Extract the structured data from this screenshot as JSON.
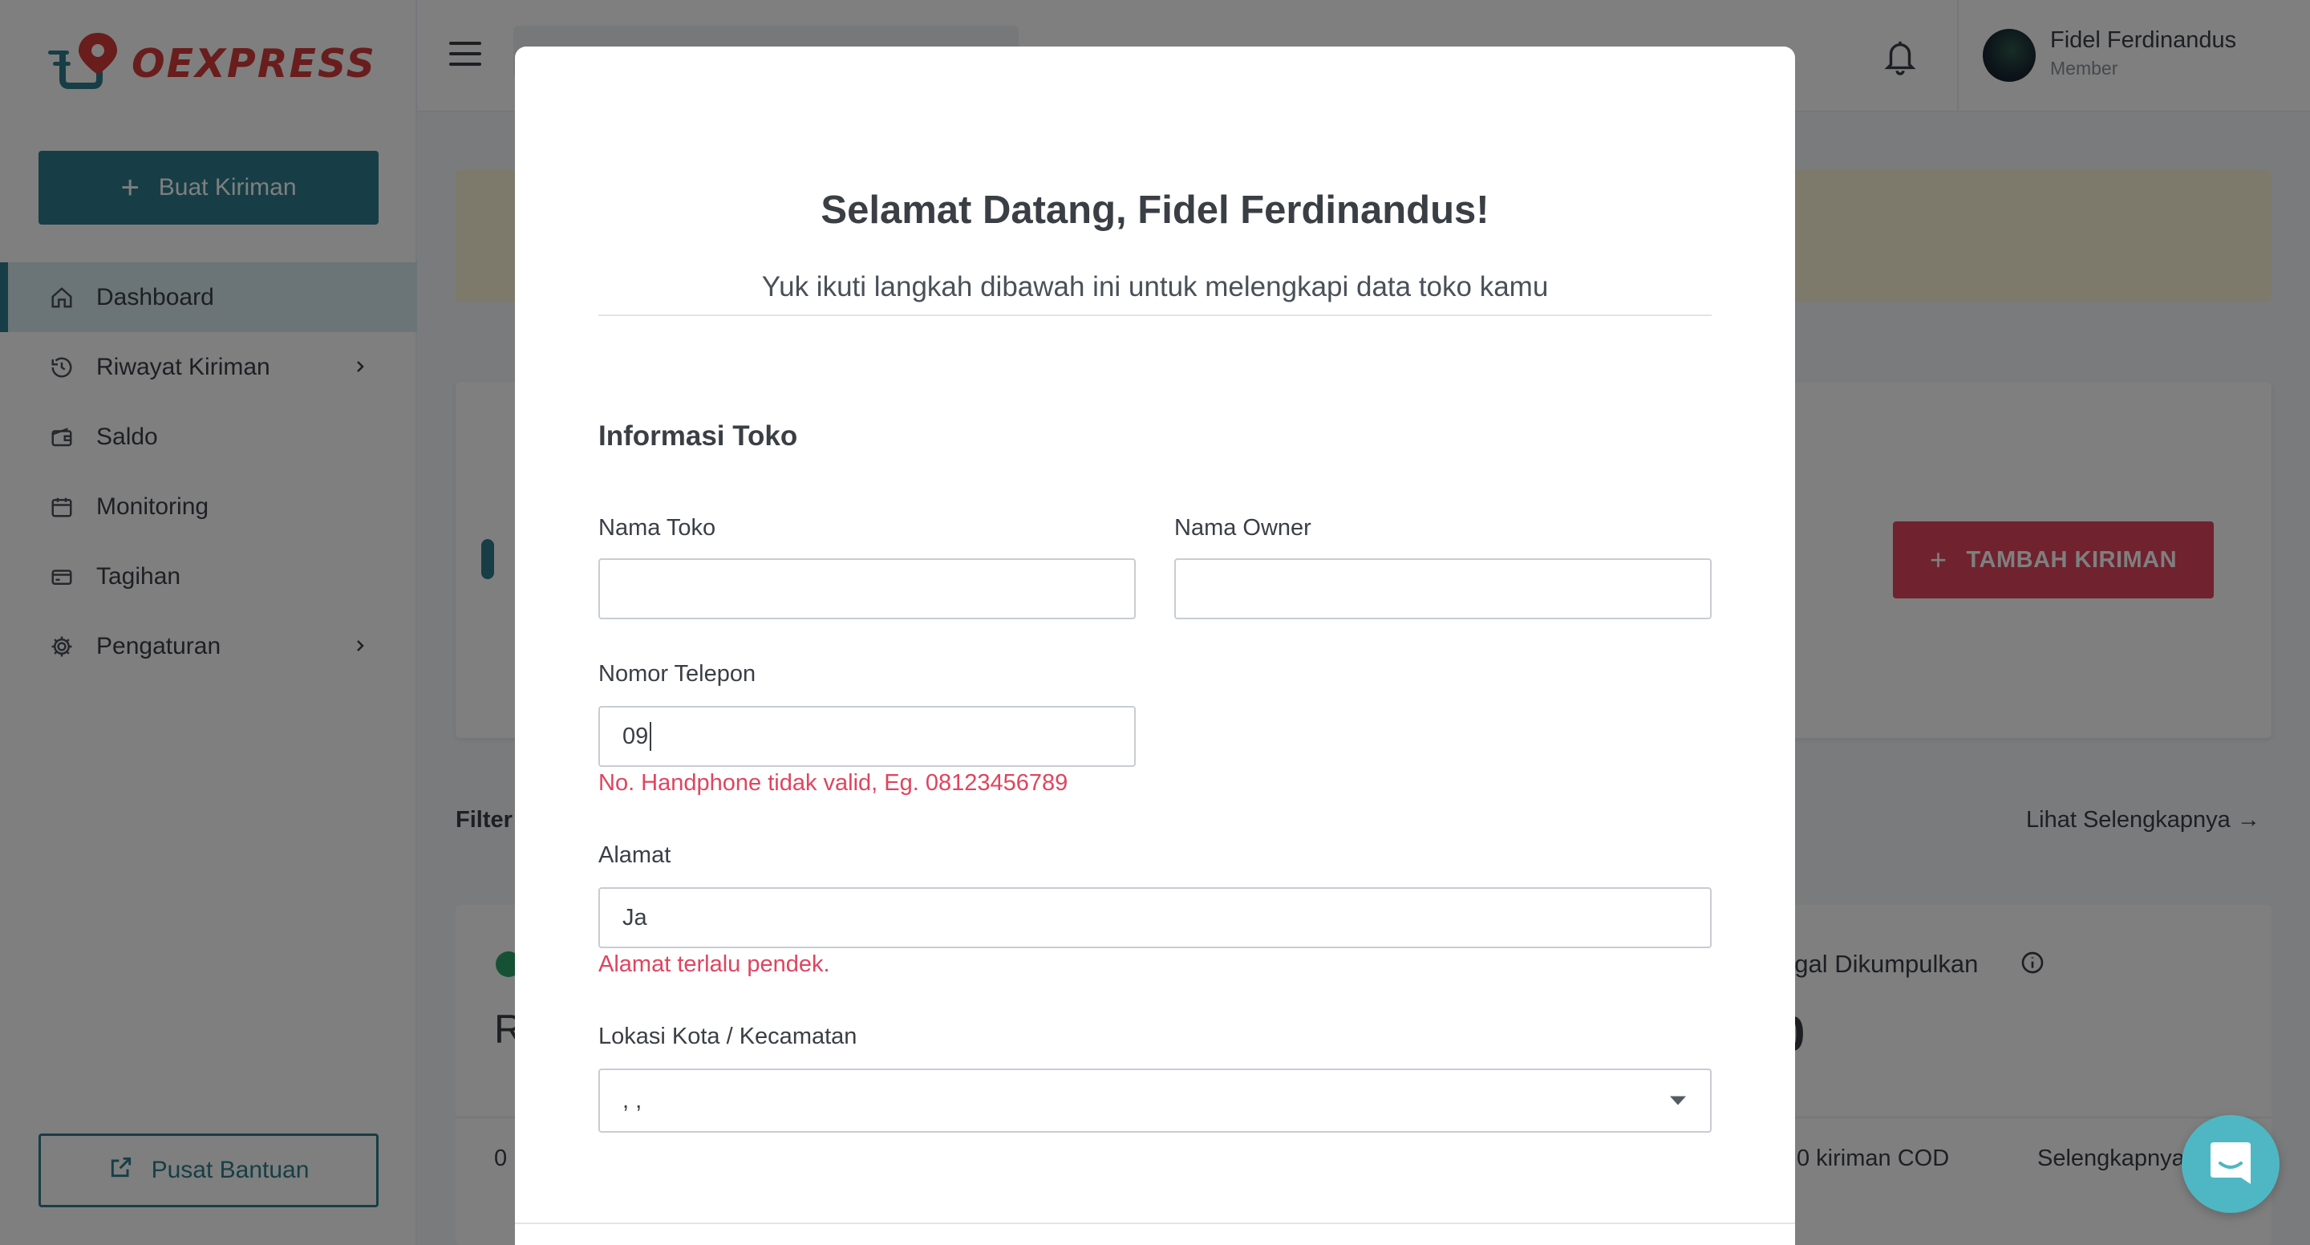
{
  "brand": {
    "name": "OEXPRESS",
    "color": "#d23a3a"
  },
  "sidebar": {
    "create_button": {
      "label": "Buat Kiriman",
      "icon": "plus-icon"
    },
    "items": [
      {
        "label": "Dashboard",
        "icon": "home-icon",
        "active": true,
        "has_submenu": false
      },
      {
        "label": "Riwayat Kiriman",
        "icon": "history-icon",
        "active": false,
        "has_submenu": true
      },
      {
        "label": "Saldo",
        "icon": "wallet-icon",
        "active": false,
        "has_submenu": false
      },
      {
        "label": "Monitoring",
        "icon": "calendar-icon",
        "active": false,
        "has_submenu": false
      },
      {
        "label": "Tagihan",
        "icon": "card-icon",
        "active": false,
        "has_submenu": false
      },
      {
        "label": "Pengaturan",
        "icon": "gear-icon",
        "active": false,
        "has_submenu": true
      }
    ],
    "help_button": {
      "label": "Pusat Bantuan",
      "icon": "external-link-icon"
    }
  },
  "topbar": {
    "user": {
      "name": "Fidel Ferdinandus",
      "role": "Member"
    }
  },
  "dashboard": {
    "add_shipping_button": "TAMBAH KIRIMAN",
    "filter_label": "Filter",
    "see_more_link": "Lihat Selengkapnya",
    "card_value_prefix": "R",
    "card_footer_left": "0",
    "failed_label": "agal Dikumpulkan",
    "failed_value": "0",
    "cod_count": "0 kiriman COD",
    "details_link": "Selengkapnya"
  },
  "modal": {
    "title": "Selamat Datang, Fidel Ferdinandus!",
    "subtitle": "Yuk ikuti langkah dibawah ini untuk melengkapi data toko kamu",
    "section_title": "Informasi Toko",
    "fields": {
      "store_name": {
        "label": "Nama Toko",
        "value": ""
      },
      "owner_name": {
        "label": "Nama Owner",
        "value": ""
      },
      "phone": {
        "label": "Nomor Telepon",
        "value": "09",
        "error": "No. Handphone tidak valid, Eg. 08123456789"
      },
      "address": {
        "label": "Alamat",
        "value": "Ja",
        "error": "Alamat terlalu pendek."
      },
      "location": {
        "label": "Lokasi Kota / Kecamatan",
        "value": ", ,"
      }
    }
  },
  "colors": {
    "primary": "#2e7d8c",
    "danger": "#e0445f",
    "warning_banner": "#fbf2d6",
    "chat_launcher": "#4fb7c4"
  }
}
